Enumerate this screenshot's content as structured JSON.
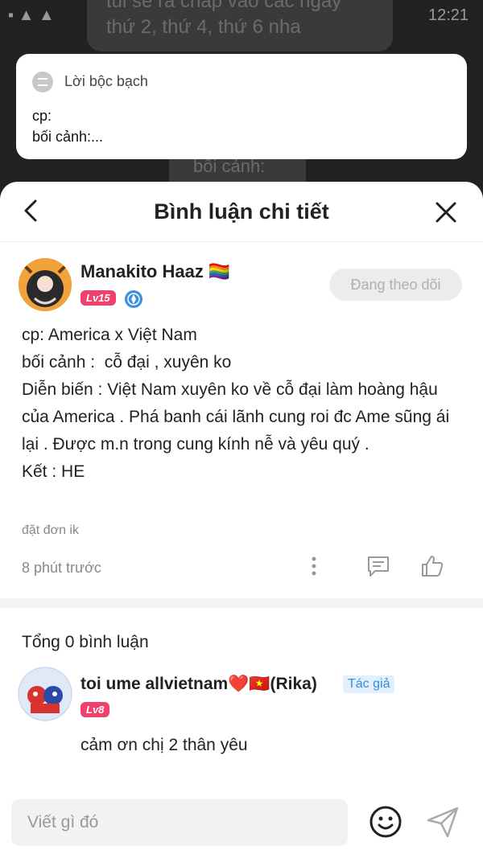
{
  "background": {
    "line1": "tui sẽ ra chap vào các ngày",
    "line2": "thứ 2, thứ 4, thứ 6 nha",
    "line3": "bối cảnh:",
    "time": "12:21"
  },
  "notice": {
    "title": "Lời bộc bạch",
    "body": "cp:\nbối cảnh:..."
  },
  "header": {
    "title": "Bình luận chi tiết"
  },
  "post": {
    "username": "Manakito Haaz 🏳️‍🌈",
    "level": "Lv15",
    "follow_label": "Đang theo dõi",
    "text": "cp: America x Việt Nam\nbối cảnh :  cỗ đại , xuyên ko\nDiễn biến : Việt Nam xuyên ko về cỗ đại làm hoàng hậu của America . Phá banh cái lãnh cung roi đc Ame sũng ái lại . Được m.n trong cung kính nễ và yêu quý .\nKết : HE",
    "tag": "đặt đơn ik",
    "time": "8 phút trước"
  },
  "comments": {
    "total": "Tổng 0 bình luận",
    "items": [
      {
        "username": "toi ume allvietnam❤️🇻🇳(Rika)",
        "author_badge": "Tác giả",
        "level": "Lv8",
        "text": "cảm ơn chị 2 thân yêu"
      }
    ]
  },
  "composer": {
    "placeholder": "Viết gì đó"
  },
  "colors": {
    "level_badge": "#f0406b",
    "author_badge": "#2d8fe0"
  }
}
